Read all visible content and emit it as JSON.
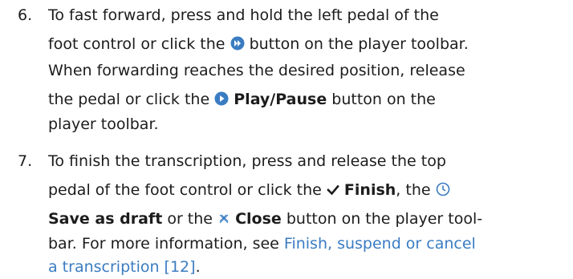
{
  "steps": [
    {
      "number": "6.",
      "line1": "To fast forward, press and hold the left pedal of the",
      "line2_a": "foot control or click the",
      "line2_b": "button on the player toolbar.",
      "line3": "When forwarding reaches the desired position, release",
      "line4_a": "the pedal or click the",
      "line4_bold": "Play/Pause",
      "line4_b": "button on the",
      "line5": "player toolbar."
    },
    {
      "number": "7.",
      "line1": "To finish the transcription, press and release the top",
      "line2_a": "pedal of the foot control or click the",
      "line2_bold": "Finish",
      "line2_b": ", the",
      "line3_bold": "Save as draft",
      "line3_a": "or the",
      "line3_bold2": "Close",
      "line3_b": "button on the player tool-",
      "line4": "bar. For more information, see",
      "line4_link": "Finish, suspend or cancel",
      "line5_link": "a transcription [12]",
      "line5_end": "."
    }
  ],
  "icons": {
    "fast_forward": "fast-forward-icon",
    "play": "play-icon",
    "finish": "checkmark-icon",
    "save_draft": "clock-icon",
    "close": "close-icon"
  },
  "colors": {
    "text": "#1c1c1c",
    "link": "#3a7cc2",
    "icon_blue": "#3a7cc2"
  }
}
